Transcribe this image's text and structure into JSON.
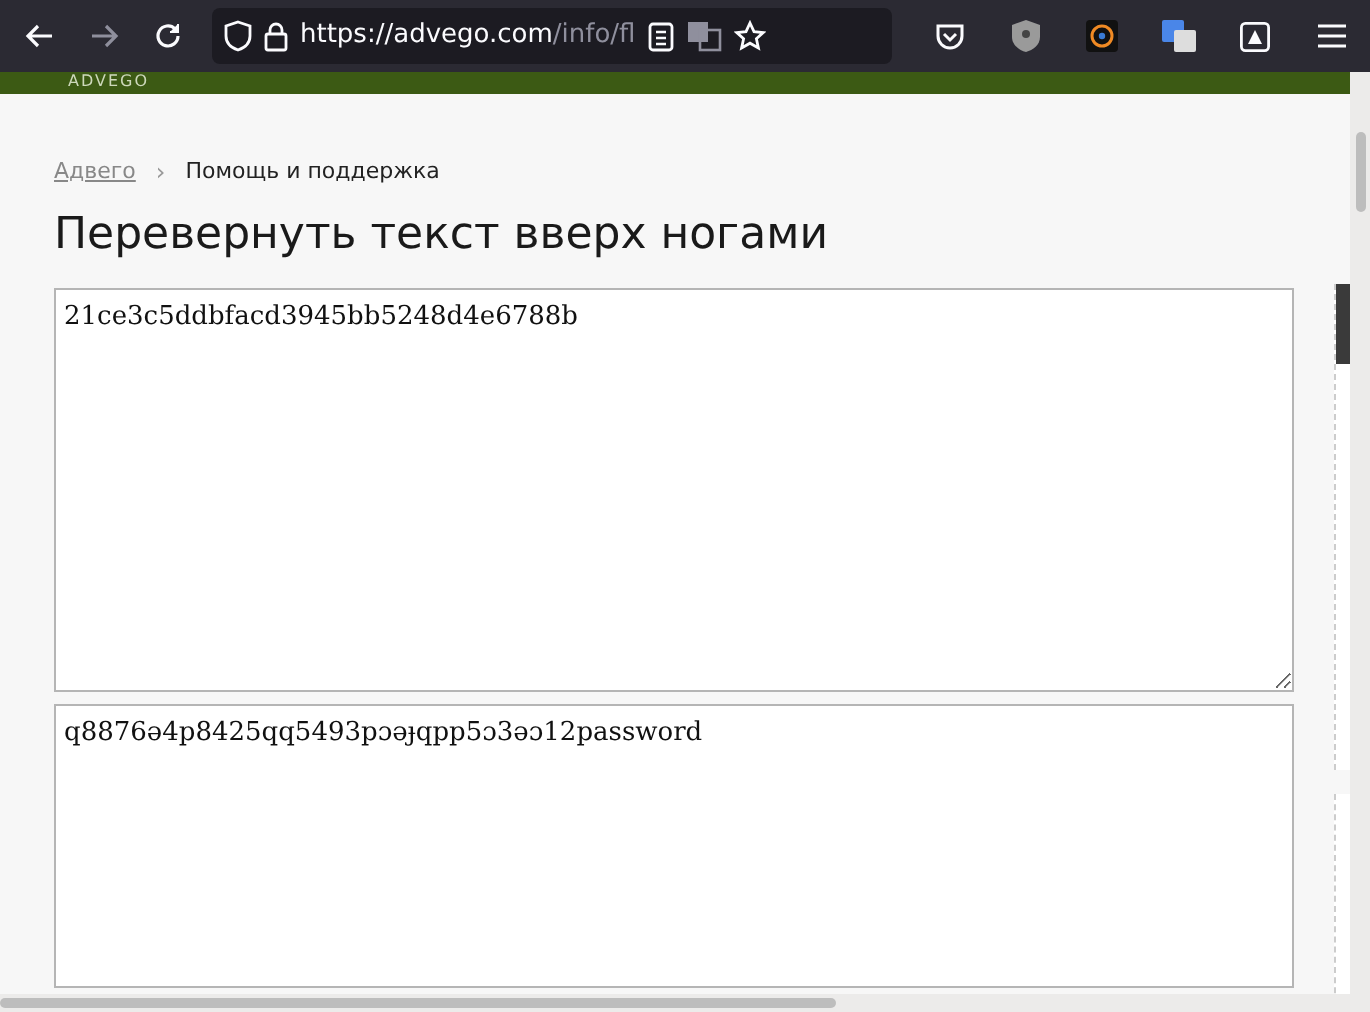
{
  "browser": {
    "url_host": "https://advego.com",
    "url_path": "/info/fl"
  },
  "site": {
    "logo": "ADVEGO"
  },
  "breadcrumbs": [
    {
      "label": "Адвего",
      "kind": "link"
    },
    {
      "label": "Помощь и поддержка",
      "kind": "current"
    }
  ],
  "breadcrumb_separator": "›",
  "title": "Перевернуть текст вверх ногами",
  "input": {
    "value": "21ce3c5ddbfacd3945bb5248d4e6788b"
  },
  "output": {
    "value": "q8876ə4p8425qq5493pɔəɟqpp5ɔ3əɔ12password"
  }
}
